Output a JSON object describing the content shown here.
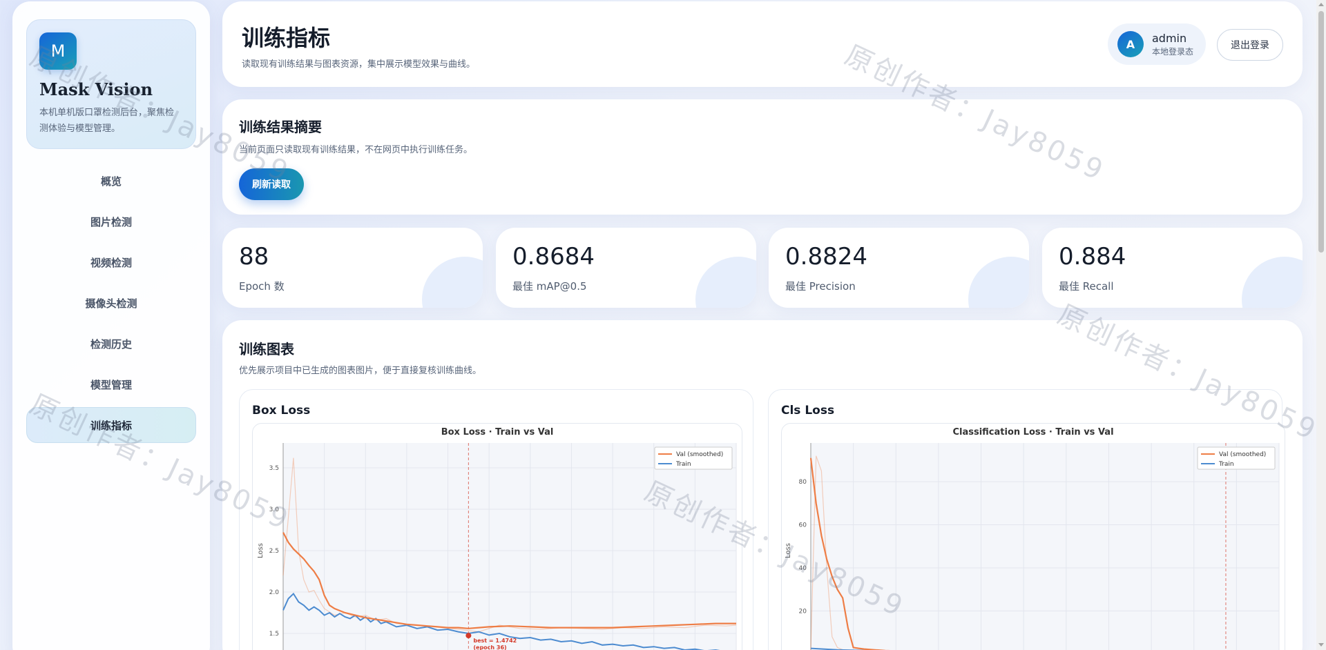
{
  "sidebar": {
    "logo_letter": "M",
    "brand_name": "Mask Vision",
    "brand_desc_line1": "本机单机版口罩检测后台，聚焦检",
    "brand_desc_line2": "测体验与模型管理。",
    "items": [
      {
        "label": "概览"
      },
      {
        "label": "图片检测"
      },
      {
        "label": "视频检测"
      },
      {
        "label": "摄像头检测"
      },
      {
        "label": "检测历史"
      },
      {
        "label": "模型管理"
      },
      {
        "label": "训练指标",
        "active": true
      }
    ]
  },
  "header": {
    "title": "训练指标",
    "subtitle": "读取现有训练结果与图表资源，集中展示模型效果与曲线。",
    "avatar_letter": "A",
    "user_name": "admin",
    "user_status": "本地登录态",
    "logout_label": "退出登录"
  },
  "summary": {
    "title": "训练结果摘要",
    "subtitle": "当前页面只读取现有训练结果，不在网页中执行训练任务。",
    "refresh_label": "刷新读取"
  },
  "stats": [
    {
      "value": "88",
      "label": "Epoch 数"
    },
    {
      "value": "0.8684",
      "label": "最佳 mAP@0.5"
    },
    {
      "value": "0.8824",
      "label": "最佳 Precision"
    },
    {
      "value": "0.884",
      "label": "最佳 Recall"
    }
  ],
  "charts_section": {
    "title": "训练图表",
    "subtitle": "优先展示项目中已生成的图表图片，便于直接复核训练曲线。"
  },
  "watermark_text": "原创作者：Jay8059",
  "colors": {
    "accent_blue": "#1565d8",
    "accent_teal": "#1aa0b7",
    "val_line": "#ee7d45",
    "train_line": "#4c8bd0",
    "best_marker": "#d43a2a"
  },
  "chart_data": [
    {
      "type": "line",
      "panel_title": "Box Loss",
      "title": "Box Loss · Train vs Val",
      "xlabel": "",
      "ylabel": "Loss",
      "xlim": [
        0,
        88
      ],
      "ylim": [
        1.2,
        3.8
      ],
      "yticks": [
        "1.5",
        "2.0",
        "2.5",
        "3.0",
        "3.5"
      ],
      "grid": true,
      "legend": "top-right",
      "legend_entries": [
        "Val (smoothed)",
        "Train"
      ],
      "best_epoch": 36,
      "best_value": 1.4742,
      "best_label_line1": "best = 1.4742",
      "best_label_line2": "(epoch 36)",
      "series": [
        {
          "name": "Val (smoothed)",
          "x": [
            0,
            1,
            2,
            3,
            4,
            5,
            6,
            7,
            8,
            9,
            10,
            12,
            14,
            16,
            18,
            20,
            22,
            24,
            26,
            28,
            30,
            32,
            34,
            36,
            38,
            40,
            44,
            48,
            52,
            56,
            60,
            64,
            68,
            72,
            76,
            80,
            84,
            88
          ],
          "values": [
            2.72,
            2.6,
            2.52,
            2.46,
            2.4,
            2.32,
            2.25,
            2.15,
            1.96,
            1.84,
            1.8,
            1.75,
            1.72,
            1.69,
            1.67,
            1.65,
            1.63,
            1.61,
            1.6,
            1.59,
            1.58,
            1.57,
            1.57,
            1.56,
            1.57,
            1.58,
            1.59,
            1.58,
            1.57,
            1.57,
            1.57,
            1.57,
            1.58,
            1.59,
            1.6,
            1.61,
            1.62,
            1.62
          ]
        },
        {
          "name": "Val (raw)",
          "x": [
            0,
            1,
            2,
            3,
            4,
            5,
            6,
            7,
            8,
            10,
            12,
            14,
            16,
            18,
            20,
            22,
            26,
            30,
            34,
            38,
            42,
            46,
            50,
            54,
            58,
            62,
            66,
            70,
            74,
            78,
            82,
            86,
            88
          ],
          "values": [
            2.2,
            2.9,
            3.62,
            2.5,
            2.15,
            2.0,
            2.02,
            1.9,
            1.8,
            1.72,
            1.75,
            1.7,
            1.72,
            1.66,
            1.68,
            1.62,
            1.6,
            1.58,
            1.55,
            1.52,
            1.6,
            1.56,
            1.55,
            1.57,
            1.56,
            1.55,
            1.57,
            1.56,
            1.58,
            1.57,
            1.6,
            1.59,
            1.6
          ]
        },
        {
          "name": "Train",
          "x": [
            0,
            1,
            2,
            3,
            4,
            5,
            6,
            7,
            8,
            9,
            10,
            11,
            12,
            13,
            14,
            15,
            16,
            17,
            18,
            19,
            20,
            22,
            24,
            26,
            28,
            30,
            32,
            34,
            36,
            38,
            40,
            42,
            44,
            46,
            48,
            50,
            52,
            54,
            56,
            58,
            60,
            62,
            64,
            66,
            68,
            70,
            72,
            74,
            76,
            78,
            80,
            82,
            84,
            86,
            88
          ],
          "values": [
            1.78,
            1.92,
            1.98,
            1.88,
            1.84,
            1.78,
            1.82,
            1.78,
            1.72,
            1.75,
            1.7,
            1.74,
            1.7,
            1.68,
            1.72,
            1.66,
            1.7,
            1.64,
            1.68,
            1.62,
            1.64,
            1.58,
            1.6,
            1.56,
            1.58,
            1.54,
            1.55,
            1.52,
            1.5,
            1.52,
            1.48,
            1.5,
            1.46,
            1.44,
            1.45,
            1.42,
            1.43,
            1.4,
            1.41,
            1.38,
            1.4,
            1.36,
            1.37,
            1.35,
            1.36,
            1.33,
            1.34,
            1.32,
            1.33,
            1.3,
            1.31,
            1.29,
            1.3,
            1.28,
            1.27
          ]
        }
      ]
    },
    {
      "type": "line",
      "panel_title": "Cls Loss",
      "title": "Classification Loss · Train vs Val",
      "xlabel": "",
      "ylabel": "Loss",
      "xlim": [
        0,
        88
      ],
      "ylim": [
        -2,
        98
      ],
      "yticks": [
        "20",
        "40",
        "60",
        "80"
      ],
      "grid": true,
      "legend": "top-right",
      "legend_entries": [
        "Val (smoothed)",
        "Train"
      ],
      "best_epoch": 78,
      "series": [
        {
          "name": "Val (smoothed)",
          "x": [
            0,
            1,
            2,
            3,
            4,
            5,
            6,
            7,
            8,
            9,
            10,
            12,
            14,
            16,
            20,
            30,
            40,
            50,
            60,
            70,
            80,
            88
          ],
          "values": [
            91,
            70,
            55,
            44,
            36,
            30,
            26,
            12,
            3,
            2.6,
            2.3,
            1.9,
            1.6,
            1.4,
            1.1,
            0.8,
            0.6,
            0.5,
            0.5,
            0.4,
            0.4,
            0.4
          ]
        },
        {
          "name": "Val (raw)",
          "x": [
            0,
            1,
            2,
            3,
            4,
            5,
            6,
            7,
            8,
            10,
            14,
            20,
            30,
            50,
            88
          ],
          "values": [
            2,
            92,
            85,
            40,
            8,
            3,
            2,
            1.5,
            1.2,
            1,
            0.8,
            0.6,
            0.5,
            0.4,
            0.3
          ]
        },
        {
          "name": "Train",
          "x": [
            0,
            5,
            10,
            20,
            30,
            40,
            50,
            60,
            70,
            80,
            88
          ],
          "values": [
            2.6,
            1.9,
            1.6,
            1.2,
            0.9,
            0.7,
            0.6,
            0.5,
            0.4,
            0.3,
            0.3
          ]
        }
      ]
    }
  ]
}
